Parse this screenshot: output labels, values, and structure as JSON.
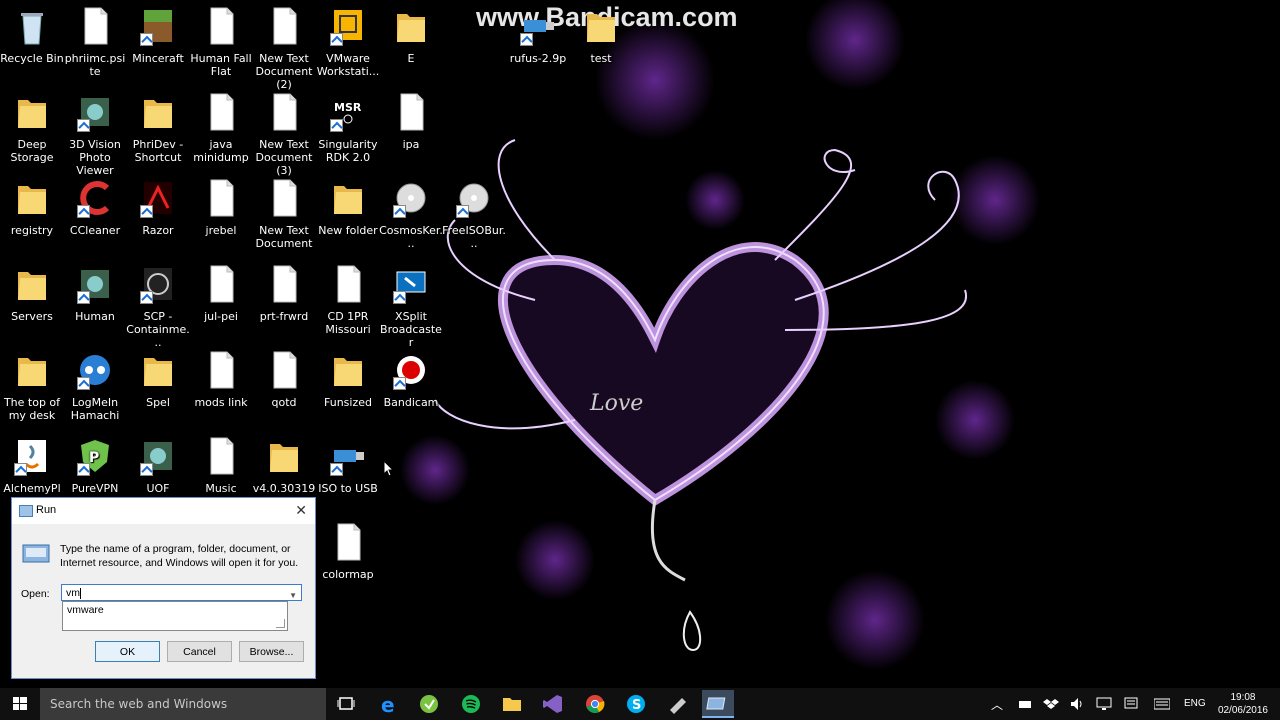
{
  "watermark": "www.Bandicam.com",
  "desktop_icons": [
    {
      "label": "Recycle Bin",
      "kind": "bin"
    },
    {
      "label": "phriimc.psite",
      "kind": "file"
    },
    {
      "label": "Minceraft",
      "kind": "grass"
    },
    {
      "label": "Human Fall Flat",
      "kind": "file"
    },
    {
      "label": "New Text Document (2)",
      "kind": "file"
    },
    {
      "label": "VMware Workstati...",
      "kind": "vmware"
    },
    {
      "label": "E",
      "kind": "folder"
    },
    {
      "label": "Deep Storage",
      "kind": "folder"
    },
    {
      "label": "3D Vision Photo Viewer",
      "kind": "app"
    },
    {
      "label": "PhriDev - Shortcut",
      "kind": "folder"
    },
    {
      "label": "java minidump",
      "kind": "file"
    },
    {
      "label": "New Text Document (3)",
      "kind": "file"
    },
    {
      "label": "Singularity RDK 2.0",
      "kind": "msr"
    },
    {
      "label": "ipa",
      "kind": "file"
    },
    {
      "label": "registry",
      "kind": "folder"
    },
    {
      "label": "CCleaner",
      "kind": "ccleaner"
    },
    {
      "label": "Razor",
      "kind": "razor"
    },
    {
      "label": "jrebel",
      "kind": "file"
    },
    {
      "label": "New Text Document",
      "kind": "file"
    },
    {
      "label": "New folder",
      "kind": "folder"
    },
    {
      "label": "CosmosKer...",
      "kind": "disc"
    },
    {
      "label": "FreeISOBur...",
      "kind": "disc"
    },
    {
      "label": "Servers",
      "kind": "folder"
    },
    {
      "label": "Human",
      "kind": "app"
    },
    {
      "label": "SCP - Containme...",
      "kind": "scp"
    },
    {
      "label": "jul-pei",
      "kind": "file"
    },
    {
      "label": "prt-frwrd",
      "kind": "file"
    },
    {
      "label": "CD 1PR Missouri",
      "kind": "file"
    },
    {
      "label": "XSplit Broadcaster",
      "kind": "xsplit"
    },
    {
      "label": "The top of my desk",
      "kind": "folder"
    },
    {
      "label": "LogMeIn Hamachi",
      "kind": "hamachi"
    },
    {
      "label": "Spel",
      "kind": "folder"
    },
    {
      "label": "mods link",
      "kind": "file"
    },
    {
      "label": "qotd",
      "kind": "file"
    },
    {
      "label": "Funsized",
      "kind": "folder"
    },
    {
      "label": "Bandicam",
      "kind": "bandicam"
    },
    {
      "label": "AlchemyPlu...",
      "kind": "java"
    },
    {
      "label": "PureVPN",
      "kind": "purevpn"
    },
    {
      "label": "UOF Launcher",
      "kind": "app"
    },
    {
      "label": "Music",
      "kind": "file"
    },
    {
      "label": "v4.0.30319 - Shortcut",
      "kind": "folder"
    },
    {
      "label": "ISO to USB",
      "kind": "usb"
    },
    {
      "label": "colormap",
      "kind": "file"
    },
    {
      "label": "rufus-2.9p",
      "kind": "usb"
    },
    {
      "label": "test",
      "kind": "folder"
    }
  ],
  "run_dialog": {
    "title": "Run",
    "description": "Type the name of a program, folder, document, or Internet resource, and Windows will open it for you.",
    "open_label": "Open:",
    "input_value": "vm",
    "suggestion": "vmware",
    "ok_label": "OK",
    "cancel_label": "Cancel",
    "browse_label": "Browse..."
  },
  "taskbar": {
    "search_placeholder": "Search the web and Windows",
    "language": "ENG",
    "time": "19:08",
    "date": "02/06/2016",
    "pinned": [
      "task-view",
      "edge",
      "greenapp",
      "spotify",
      "file-explorer",
      "visual-studio",
      "chrome",
      "skype",
      "usb-tool",
      "run"
    ]
  },
  "colors": {
    "accent": "#7fb2f0",
    "wallpaper_glow": "#b070e0",
    "taskbar": "#101010"
  }
}
